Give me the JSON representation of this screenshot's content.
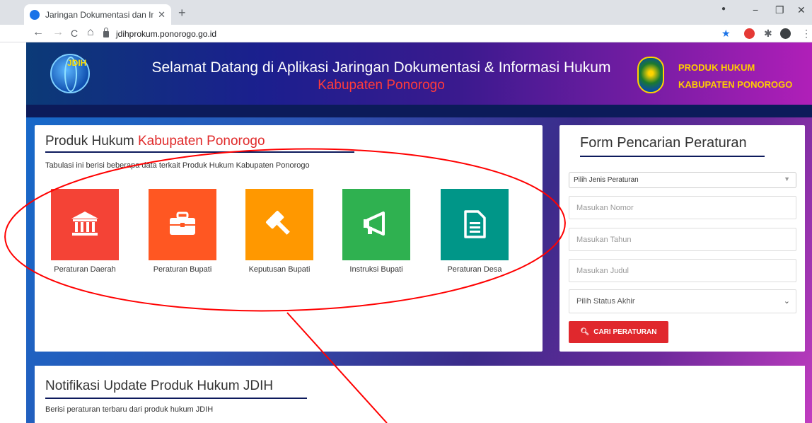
{
  "browser": {
    "tab_title": "Jaringan Dokumentasi dan Inform",
    "tab_close": "✕",
    "new_tab": "+",
    "url": "jdihprokum.ponorogo.go.id",
    "back": "←",
    "forward": "→",
    "reload": "C",
    "home": "⌂",
    "window_min": "−",
    "window_restore": "❐",
    "window_close": "✕"
  },
  "header": {
    "logo_text": "JDIH",
    "welcome": "Selamat Datang di Aplikasi Jaringan Dokumentasi & Informasi Hukum",
    "subtitle": "Kabupaten Ponorogo",
    "produk_line1": "PRODUK HUKUM",
    "produk_line2": "KABUPATEN PONOROGO"
  },
  "produk": {
    "title_prefix": "Produk Hukum ",
    "title_highlight": "Kabupaten Ponorogo",
    "description": "Tabulasi ini berisi beberapa data terkait Produk Hukum Kabupaten Ponorogo",
    "tiles": [
      {
        "label": "Peraturan Daerah",
        "color": "#f44336",
        "icon": "bank-icon"
      },
      {
        "label": "Peraturan Bupati",
        "color": "#ff5722",
        "icon": "briefcase-icon"
      },
      {
        "label": "Keputusan Bupati",
        "color": "#ff9800",
        "icon": "gavel-icon"
      },
      {
        "label": "Instruksi Bupati",
        "color": "#2fb150",
        "icon": "megaphone-icon"
      },
      {
        "label": "Peraturan Desa",
        "color": "#009688",
        "icon": "document-icon"
      }
    ]
  },
  "form": {
    "title": "Form Pencarian Peraturan",
    "jenis_select": "Pilih Jenis Peraturan",
    "nomor_placeholder": "Masukan Nomor",
    "tahun_placeholder": "Masukan Tahun",
    "judul_placeholder": "Masukan Judul",
    "status_select": "Pilih Status Akhir",
    "search_button": "CARI PERATURAN"
  },
  "notifikasi": {
    "title": "Notifikasi Update Produk Hukum JDIH",
    "description": "Berisi peraturan terbaru dari produk hukum JDIH"
  },
  "colors": {
    "accent_red": "#e0282d",
    "annotation": "#ff0000",
    "navy": "#0d1a5c"
  }
}
